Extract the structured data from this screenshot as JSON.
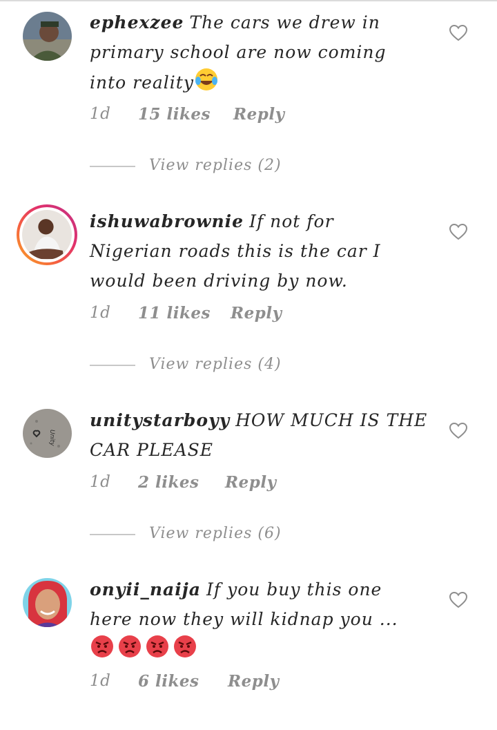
{
  "comments": [
    {
      "username": "ephexzee",
      "text_lines": [
        "The cars we drew in",
        "primary school are now coming",
        "into reality"
      ],
      "time": "1d",
      "likes": "15 likes",
      "reply": "Reply",
      "view_replies": "View replies (2)",
      "emoji": "face-with-tears-of-joy"
    },
    {
      "username": "ishuwabrownie",
      "text_lines": [
        "If not for",
        "Nigerian roads this is the car I",
        "would been driving  by now."
      ],
      "time": "1d",
      "likes": "11 likes",
      "reply": "Reply",
      "view_replies": "View replies (4)"
    },
    {
      "username": "unitystarboyy",
      "text_lines": [
        "HOW MUCH IS THE",
        "CAR PLEASE"
      ],
      "time": "1d",
      "likes": "2 likes",
      "reply": "Reply",
      "view_replies": "View replies (6)"
    },
    {
      "username": "onyii_naija",
      "text_lines": [
        "If you buy this one",
        "here now they will kidnap you ..."
      ],
      "time": "1d",
      "likes": "6 likes",
      "reply": "Reply",
      "emoji": [
        "pouting-face",
        "pouting-face",
        "pouting-face",
        "pouting-face"
      ]
    }
  ],
  "icons": {
    "like": "heart-outline-icon"
  },
  "colors": {
    "text": "#262626",
    "muted": "#8e8e8e",
    "story_ring": "#e1306c"
  }
}
